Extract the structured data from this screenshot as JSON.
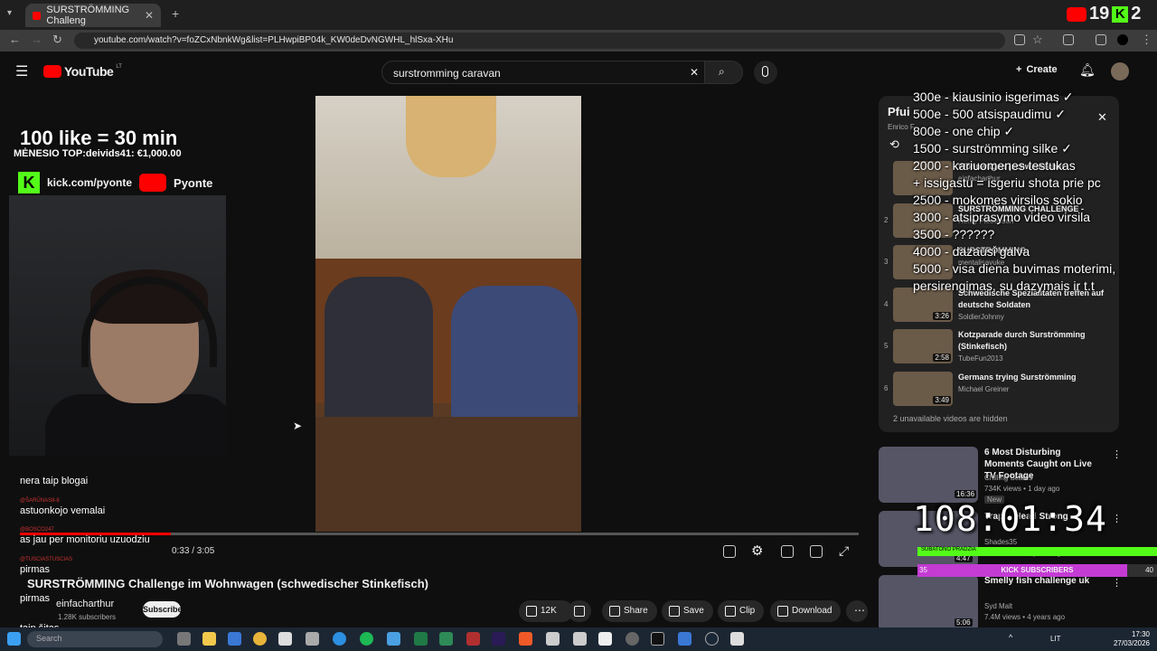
{
  "browser": {
    "tab_title": "SURSTRÖMMING Challeng",
    "url": "youtube.com/watch?v=foZCxNbnkWg&list=PLHwpiBP04k_KW0deDvNGWHL_hlSxa-XHu",
    "stream_counter_1": "19",
    "stream_counter_2": "2"
  },
  "youtube": {
    "logo": "YouTube",
    "region": "LT",
    "search_query": "surstromming caravan",
    "create_label": "Create"
  },
  "stream_overlay": {
    "like_goal": "100 like = 30 min",
    "top_donor": "MĖNESIO TOP:deivids41: €1,000.00",
    "kick_handle": "kick.com/pyonte",
    "youtube_handle": "Pyonte"
  },
  "chat": [
    {
      "user": "",
      "text": "nera taip blogai"
    },
    {
      "user": "@ŠARŪNAS8-8",
      "text": "astuonkojo vemalai"
    },
    {
      "user": "@BOSCO247",
      "text": "as jau per monitoriu uzuodziu"
    },
    {
      "user": "@TUSCIASTUSCIAS",
      "text": "pirmas"
    },
    {
      "user": "",
      "text": "pirmas"
    },
    {
      "user": "",
      "text": "taip šitas"
    }
  ],
  "player": {
    "time": "0:33 / 3:05",
    "progress": 0.18,
    "title": "SURSTRÖMMING Challenge im Wohnwagen (schwedischer Stinkefisch)",
    "channel": "einfacharthur",
    "subscribers": "1.28K subscribers",
    "subscribe_label": "Subscribe",
    "likes": "12K",
    "share_label": "Share",
    "save_label": "Save",
    "clip_label": "Clip",
    "download_label": "Download"
  },
  "playlist": {
    "title": "Pfui",
    "owner": "Enrico F",
    "items": [
      {
        "idx": "",
        "title": "Wohnwagen (schwedischer",
        "channel": "einfacharthur",
        "duration": ""
      },
      {
        "idx": "2",
        "title": "SURSTRÖMMING CHALLENGE -",
        "channel": "Henry Pietrasson",
        "duration": ""
      },
      {
        "idx": "3",
        "title": "SURSTRÖMMING",
        "channel": "mentalisavuke",
        "duration": ""
      },
      {
        "idx": "4",
        "title": "Schwedische Spezialitaten treffen auf deutsche Soldaten",
        "channel": "SoldierJohnny",
        "duration": "3:26"
      },
      {
        "idx": "5",
        "title": "Kotzparade durch Surströmming (Stinkefisch)",
        "channel": "TubeFun2013",
        "duration": "2:58"
      },
      {
        "idx": "6",
        "title": "Germans trying Surströmming",
        "channel": "Michael Greiner",
        "duration": "3:49"
      }
    ],
    "hidden_note": "2 unavailable videos are hidden"
  },
  "goals": [
    "300e - kiausinio isgerimas ✓",
    "500e - 500 atsispaudimu ✓",
    "800e - one chip ✓",
    "1500 - surströmming silke ✓",
    "2000 - kariuomenes testukas",
    "+ issigastu = isgeriu shota prie pc",
    "2500 - mokomes virsilos sokio",
    "3000 - atsiprasymo video virsila",
    "3500 - ??????",
    "4000 - dazausi galva",
    "5000 - visa diena buvimas moterimi,",
    "persirengimas, su dazymais ir t.t"
  ],
  "recommendations": [
    {
      "title": "6 Most Disturbing Moments Caught on Live TV Footage",
      "channel": "Chilling Scares",
      "meta": "734K views • 1 day ago",
      "badge": "New",
      "duration": "16:36"
    },
    {
      "title": "Trap! - Head Strong",
      "channel": "Shades35",
      "meta": "504 views • 14 years ago",
      "badge": "",
      "duration": "4:47"
    },
    {
      "title": "Smelly fish challenge uk",
      "channel": "Syd Malt",
      "meta": "7.4M views • 4 years ago",
      "badge": "",
      "duration": "5:06"
    }
  ],
  "timer": "108:01:34",
  "green_bar_label": "SUBATONO PRADZIA",
  "kick_subs": {
    "label": "KICK SUBSCRIBERS",
    "current": "35",
    "goal": "40",
    "progress": 0.875
  },
  "taskbar": {
    "search_placeholder": "Search",
    "lang": "LIT",
    "time": "17:30",
    "date": "27/03/2026"
  },
  "colors": {
    "youtube_red": "#ff0000",
    "kick_green": "#53fc18",
    "kick_purple": "#c43bd4"
  }
}
